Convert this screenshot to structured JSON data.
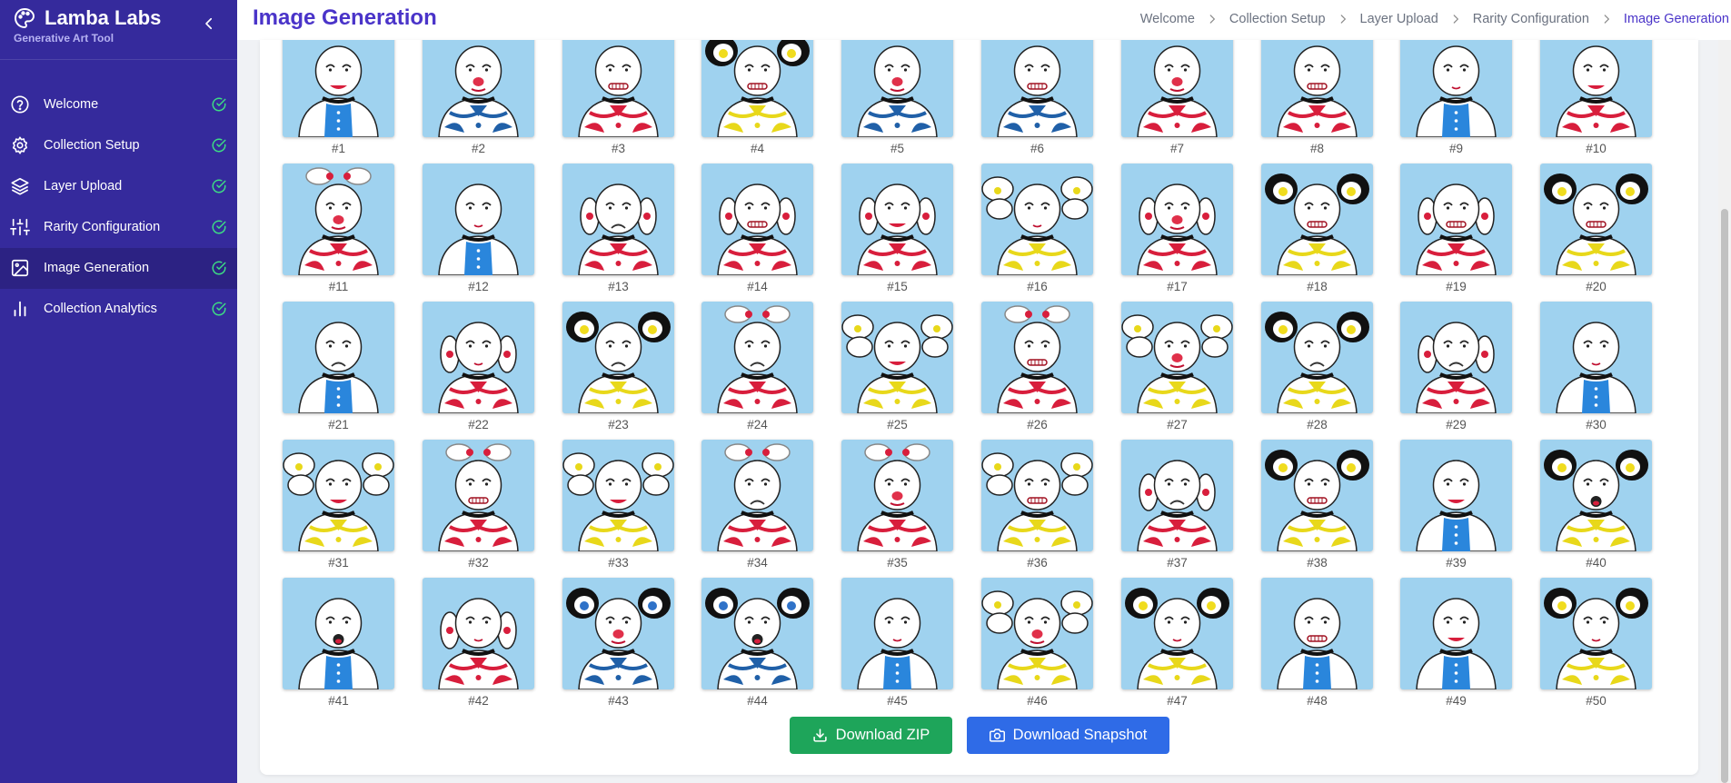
{
  "app": {
    "title": "Lamba Labs",
    "subtitle": "Generative Art Tool"
  },
  "sidebar": {
    "items": [
      {
        "label": "Welcome",
        "icon": "help-circle-icon",
        "completed": true,
        "active": false
      },
      {
        "label": "Collection Setup",
        "icon": "gear-icon",
        "completed": true,
        "active": false
      },
      {
        "label": "Layer Upload",
        "icon": "layers-icon",
        "completed": true,
        "active": false
      },
      {
        "label": "Rarity Configuration",
        "icon": "sliders-icon",
        "completed": true,
        "active": false
      },
      {
        "label": "Image Generation",
        "icon": "image-icon",
        "completed": true,
        "active": true
      },
      {
        "label": "Collection Analytics",
        "icon": "bar-chart-icon",
        "completed": true,
        "active": false
      }
    ]
  },
  "header": {
    "title": "Image Generation",
    "breadcrumb": [
      "Welcome",
      "Collection Setup",
      "Layer Upload",
      "Rarity Configuration",
      "Image Generation"
    ]
  },
  "gallery": {
    "images": [
      {
        "label": "#1",
        "ears": "none",
        "body": "blue",
        "mouth": "smile"
      },
      {
        "label": "#2",
        "ears": "none",
        "body": "blue-pattern",
        "mouth": "nose"
      },
      {
        "label": "#3",
        "ears": "none",
        "body": "red-pattern",
        "mouth": "teeth"
      },
      {
        "label": "#4",
        "ears": "black-yellow",
        "body": "yellow-pattern",
        "mouth": "teeth"
      },
      {
        "label": "#5",
        "ears": "none",
        "body": "blue-pattern",
        "mouth": "nose"
      },
      {
        "label": "#6",
        "ears": "none",
        "body": "blue-pattern",
        "mouth": "teeth"
      },
      {
        "label": "#7",
        "ears": "none",
        "body": "red-pattern",
        "mouth": "nose"
      },
      {
        "label": "#8",
        "ears": "none",
        "body": "red-pattern",
        "mouth": "teeth"
      },
      {
        "label": "#9",
        "ears": "none",
        "body": "blue",
        "mouth": "small"
      },
      {
        "label": "#10",
        "ears": "none",
        "body": "red-pattern",
        "mouth": "smile"
      },
      {
        "label": "#11",
        "ears": "white-rings",
        "body": "red-pattern",
        "mouth": "nose"
      },
      {
        "label": "#12",
        "ears": "none",
        "body": "blue",
        "mouth": "small"
      },
      {
        "label": "#13",
        "ears": "red-floppy",
        "body": "red-pattern",
        "mouth": "frown"
      },
      {
        "label": "#14",
        "ears": "red-floppy",
        "body": "red-pattern",
        "mouth": "teeth"
      },
      {
        "label": "#15",
        "ears": "red-floppy",
        "body": "red-pattern",
        "mouth": "smile"
      },
      {
        "label": "#16",
        "ears": "white-wings",
        "body": "yellow-pattern",
        "mouth": "small"
      },
      {
        "label": "#17",
        "ears": "red-floppy",
        "body": "red-pattern",
        "mouth": "nose"
      },
      {
        "label": "#18",
        "ears": "black-yellow",
        "body": "yellow-pattern",
        "mouth": "teeth"
      },
      {
        "label": "#19",
        "ears": "red-floppy",
        "body": "red-pattern",
        "mouth": "teeth"
      },
      {
        "label": "#20",
        "ears": "black-yellow",
        "body": "yellow-pattern",
        "mouth": "teeth"
      },
      {
        "label": "#21",
        "ears": "none",
        "body": "blue",
        "mouth": "frown"
      },
      {
        "label": "#22",
        "ears": "red-floppy",
        "body": "red-pattern",
        "mouth": "small"
      },
      {
        "label": "#23",
        "ears": "black-yellow",
        "body": "yellow-pattern",
        "mouth": "frown"
      },
      {
        "label": "#24",
        "ears": "white-rings",
        "body": "red-pattern",
        "mouth": "frown"
      },
      {
        "label": "#25",
        "ears": "white-wings",
        "body": "yellow-pattern",
        "mouth": "smile"
      },
      {
        "label": "#26",
        "ears": "white-rings",
        "body": "red-pattern",
        "mouth": "teeth"
      },
      {
        "label": "#27",
        "ears": "white-wings",
        "body": "yellow-pattern",
        "mouth": "nose"
      },
      {
        "label": "#28",
        "ears": "black-yellow",
        "body": "yellow-pattern",
        "mouth": "frown"
      },
      {
        "label": "#29",
        "ears": "red-floppy",
        "body": "red-pattern",
        "mouth": "frown"
      },
      {
        "label": "#30",
        "ears": "none",
        "body": "blue",
        "mouth": "small"
      },
      {
        "label": "#31",
        "ears": "white-wings",
        "body": "yellow-pattern",
        "mouth": "smile"
      },
      {
        "label": "#32",
        "ears": "white-rings",
        "body": "red-pattern",
        "mouth": "teeth"
      },
      {
        "label": "#33",
        "ears": "white-wings",
        "body": "yellow-pattern",
        "mouth": "smile"
      },
      {
        "label": "#34",
        "ears": "white-rings",
        "body": "red-pattern",
        "mouth": "frown"
      },
      {
        "label": "#35",
        "ears": "white-rings",
        "body": "red-pattern",
        "mouth": "nose"
      },
      {
        "label": "#36",
        "ears": "white-wings",
        "body": "yellow-pattern",
        "mouth": "teeth"
      },
      {
        "label": "#37",
        "ears": "red-floppy",
        "body": "red-pattern",
        "mouth": "frown"
      },
      {
        "label": "#38",
        "ears": "black-yellow",
        "body": "yellow-pattern",
        "mouth": "teeth"
      },
      {
        "label": "#39",
        "ears": "none",
        "body": "blue",
        "mouth": "smile"
      },
      {
        "label": "#40",
        "ears": "black-yellow",
        "body": "yellow-pattern",
        "mouth": "open"
      },
      {
        "label": "#41",
        "ears": "none",
        "body": "blue",
        "mouth": "open"
      },
      {
        "label": "#42",
        "ears": "red-floppy",
        "body": "red-pattern",
        "mouth": "small"
      },
      {
        "label": "#43",
        "ears": "black-blue",
        "body": "blue-pattern",
        "mouth": "nose"
      },
      {
        "label": "#44",
        "ears": "black-blue",
        "body": "blue-pattern",
        "mouth": "open"
      },
      {
        "label": "#45",
        "ears": "none",
        "body": "blue",
        "mouth": "small"
      },
      {
        "label": "#46",
        "ears": "white-wings",
        "body": "yellow-pattern",
        "mouth": "nose"
      },
      {
        "label": "#47",
        "ears": "black-yellow",
        "body": "yellow-pattern",
        "mouth": "small"
      },
      {
        "label": "#48",
        "ears": "none",
        "body": "blue",
        "mouth": "teeth"
      },
      {
        "label": "#49",
        "ears": "none",
        "body": "blue",
        "mouth": "smile"
      },
      {
        "label": "#50",
        "ears": "black-yellow",
        "body": "yellow-pattern",
        "mouth": "small"
      }
    ]
  },
  "actions": {
    "download_zip": "Download ZIP",
    "download_snapshot": "Download Snapshot"
  },
  "colors": {
    "sidebar_bg": "#352a9c",
    "sidebar_active": "#2c2283",
    "accent": "#4a34c9",
    "check": "#3ddc84",
    "tile_bg": "#9fd2ef",
    "zip_button": "#1ea55a",
    "snapshot_button": "#2f6be7"
  }
}
